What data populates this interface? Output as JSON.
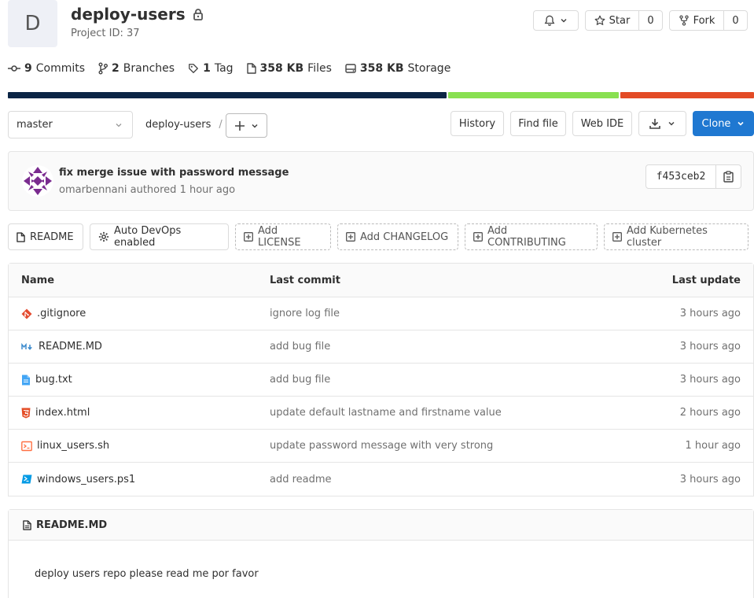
{
  "project": {
    "avatar_letter": "D",
    "name": "deploy-users",
    "project_id": "Project ID: 37"
  },
  "actions": {
    "star_label": "Star",
    "star_count": "0",
    "fork_label": "Fork",
    "fork_count": "0"
  },
  "stats": [
    {
      "count": "9",
      "label": "Commits",
      "icon": "commit-icon"
    },
    {
      "count": "2",
      "label": "Branches",
      "icon": "branch-icon"
    },
    {
      "count": "1",
      "label": "Tag",
      "icon": "tag-icon"
    },
    {
      "count": "358 KB",
      "label": "Files",
      "icon": "file-icon"
    },
    {
      "count": "358 KB",
      "label": "Storage",
      "icon": "storage-icon"
    }
  ],
  "languages": [
    {
      "share": 59,
      "color": "#0b2545"
    },
    {
      "share": 23,
      "color": "#89e051"
    },
    {
      "share": 18,
      "color": "#e34c26"
    }
  ],
  "branch": {
    "selected": "master",
    "path_root": "deploy-users",
    "separator": "/"
  },
  "toolbar": {
    "history": "History",
    "find_file": "Find file",
    "web_ide": "Web IDE",
    "clone": "Clone"
  },
  "last_commit": {
    "message": "fix merge issue with password message",
    "author": "omarbennani",
    "authored_word": "authored",
    "time": "1 hour ago",
    "sha": "f453ceb2"
  },
  "quick_actions": [
    {
      "label": "README",
      "style": "solid",
      "icon": "file-icon"
    },
    {
      "label": "Auto DevOps enabled",
      "style": "solid",
      "icon": "gear-icon"
    },
    {
      "label": "Add LICENSE",
      "style": "dashed",
      "icon": "plus-square-icon"
    },
    {
      "label": "Add CHANGELOG",
      "style": "dashed",
      "icon": "plus-square-icon"
    },
    {
      "label": "Add CONTRIBUTING",
      "style": "dashed",
      "icon": "plus-square-icon"
    },
    {
      "label": "Add Kubernetes cluster",
      "style": "dashed",
      "icon": "plus-square-icon"
    }
  ],
  "tree": {
    "headers": {
      "name": "Name",
      "last_commit": "Last commit",
      "last_update": "Last update"
    },
    "rows": [
      {
        "name": ".gitignore",
        "icon": "git-icon",
        "commit": "ignore log file",
        "time": "3 hours ago"
      },
      {
        "name": "README.MD",
        "icon": "markdown-icon",
        "commit": "add bug file",
        "time": "3 hours ago"
      },
      {
        "name": "bug.txt",
        "icon": "text-file-icon",
        "commit": "add bug file",
        "time": "3 hours ago"
      },
      {
        "name": "index.html",
        "icon": "html5-icon",
        "commit": "update default lastname and firstname value",
        "time": "2 hours ago"
      },
      {
        "name": "linux_users.sh",
        "icon": "shell-icon",
        "commit": "update password message with very strong",
        "time": "1 hour ago"
      },
      {
        "name": "windows_users.ps1",
        "icon": "powershell-icon",
        "commit": "add readme",
        "time": "3 hours ago"
      }
    ]
  },
  "readme": {
    "filename": "README.MD",
    "content": "deploy users repo please read me por favor"
  }
}
